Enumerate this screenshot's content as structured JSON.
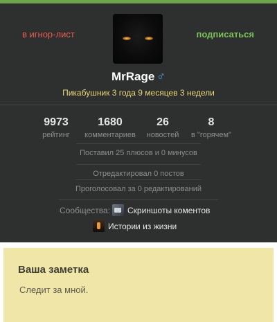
{
  "header": {
    "ignore_label": "в игнор-лист",
    "subscribe_label": "подписаться"
  },
  "profile": {
    "username": "MrRage",
    "gender_symbol": "♂",
    "tenure": "Пикабушник 3 года 9 месяцев 3 недели"
  },
  "stats": [
    {
      "value": "9973",
      "label": "рейтинг"
    },
    {
      "value": "1680",
      "label": "комментариев"
    },
    {
      "value": "26",
      "label": "новостей"
    },
    {
      "value": "8",
      "label": "в \"горячем\""
    }
  ],
  "activity": {
    "votes": "Поставил 25 плюсов и 0 минусов",
    "edited": "Отредактировал 0 постов",
    "voted_edits": "Проголосовал за 0 редактирований"
  },
  "communities": {
    "label": "Сообщества:",
    "items": [
      {
        "name": "Скриншоты коментов",
        "icon": "screenshot-community-icon"
      },
      {
        "name": "Истории из жизни",
        "icon": "life-stories-community-icon"
      }
    ]
  },
  "note": {
    "title": "Ваша заметка",
    "text": "Следит за мной."
  },
  "colors": {
    "background": "#2e2f2f",
    "accent_green": "#7ac15a",
    "ignore_red": "#e6604f",
    "tenure_yellow": "#e8d87a",
    "note_background": "#f0e6a8"
  }
}
